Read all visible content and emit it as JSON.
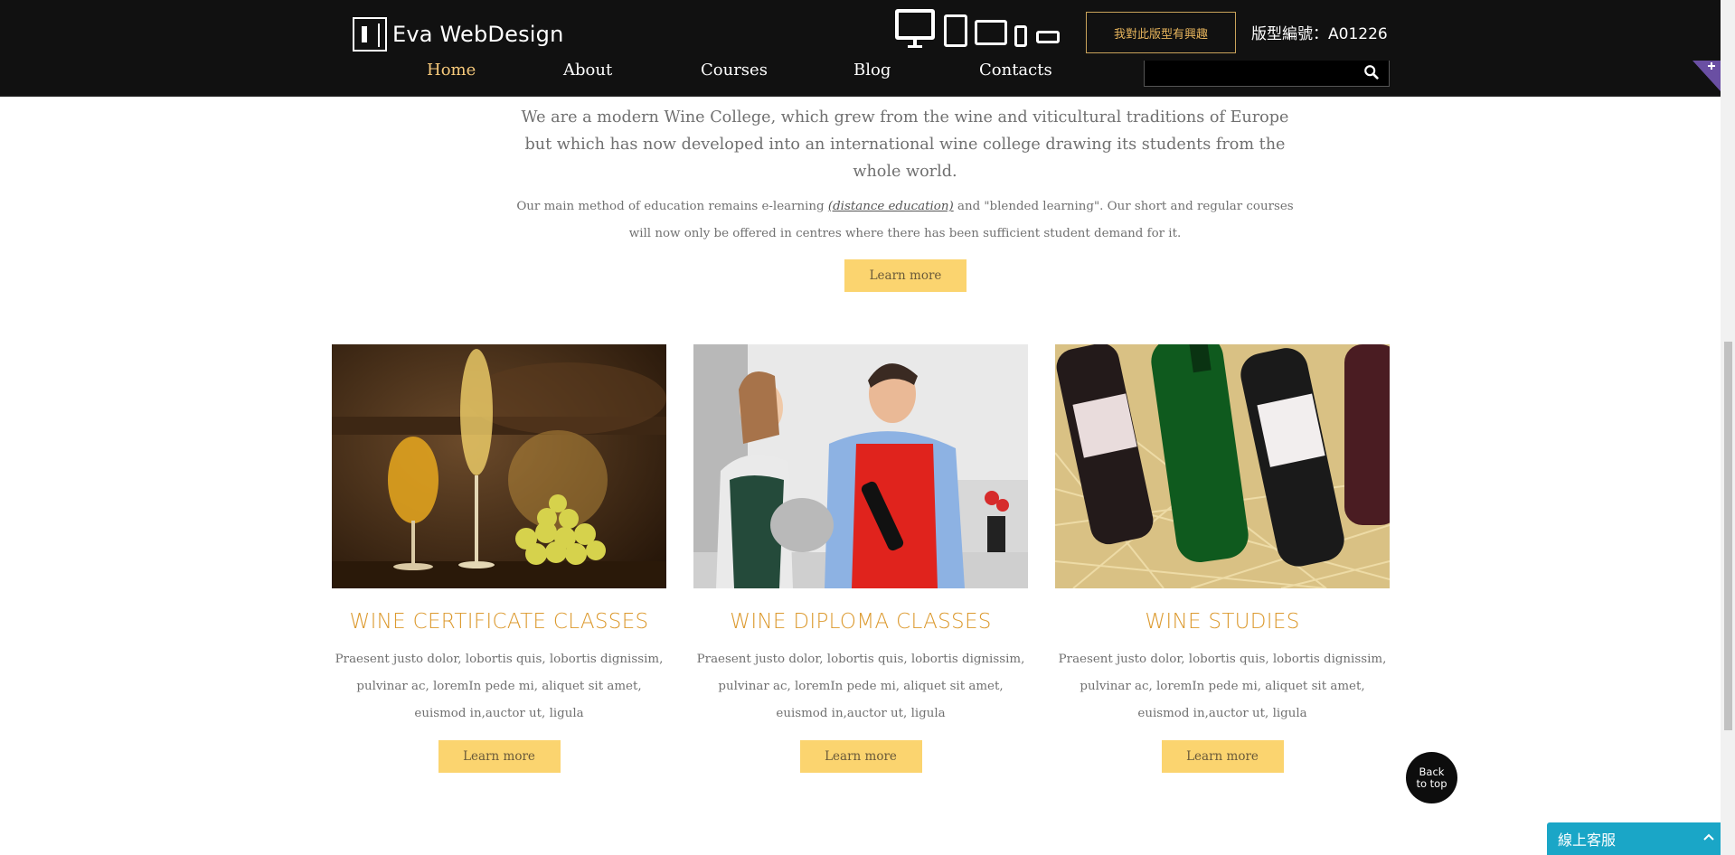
{
  "header": {
    "logo_text": "Eva WebDesign",
    "device_icons": [
      "desktop-icon",
      "tablet-icon",
      "tablet-landscape-icon",
      "phone-icon",
      "phone-landscape-icon"
    ],
    "interest_button": "我對此版型有興趣",
    "template_number": "版型編號：A01226"
  },
  "nav": {
    "items": [
      {
        "label": "Home",
        "active": true
      },
      {
        "label": "About",
        "active": false
      },
      {
        "label": "Courses",
        "active": false
      },
      {
        "label": "Blog",
        "active": false
      },
      {
        "label": "Contacts",
        "active": false
      }
    ],
    "search": {
      "value": "",
      "placeholder": ""
    }
  },
  "intro": {
    "lead": "We are a modern Wine College, which grew from the wine and viticultural traditions of Europe but which has now developed into an international wine college drawing its students from the whole world.",
    "body_before": "Our main method of education remains e-learning ",
    "body_link": "(distance education)",
    "body_after": " and \"blended learning\". Our short and regular courses will now only be offered in centres where there has been sufficient student demand for it.",
    "button": "Learn more"
  },
  "cards": [
    {
      "title": "WINE CERTIFICATE CLASSES",
      "text": "Praesent justo dolor, lobortis quis, lobortis dignissim, pulvinar ac, loremIn pede mi, aliquet sit amet, euismod in,auctor ut, ligula",
      "button": "Learn more"
    },
    {
      "title": "WINE DIPLOMA CLASSES",
      "text": "Praesent justo dolor, lobortis quis, lobortis dignissim, pulvinar ac, loremIn pede mi, aliquet sit amet, euismod in,auctor ut, ligula",
      "button": "Learn more"
    },
    {
      "title": "WINE STUDIES",
      "text": "Praesent justo dolor, lobortis quis, lobortis dignissim, pulvinar ac, loremIn pede mi, aliquet sit amet, euismod in,auctor ut, ligula",
      "button": "Learn more"
    }
  ],
  "back_to_top": {
    "line1": "Back",
    "line2": "to top"
  },
  "chat": {
    "label": "線上客服"
  },
  "colors": {
    "header_bg": "#111111",
    "nav_active": "#f6c97b",
    "accent_button": "#fbd46f",
    "card_title": "#dc9a2f",
    "chat_bg": "#1aa6c7",
    "ribbon": "#6a4fa3"
  }
}
